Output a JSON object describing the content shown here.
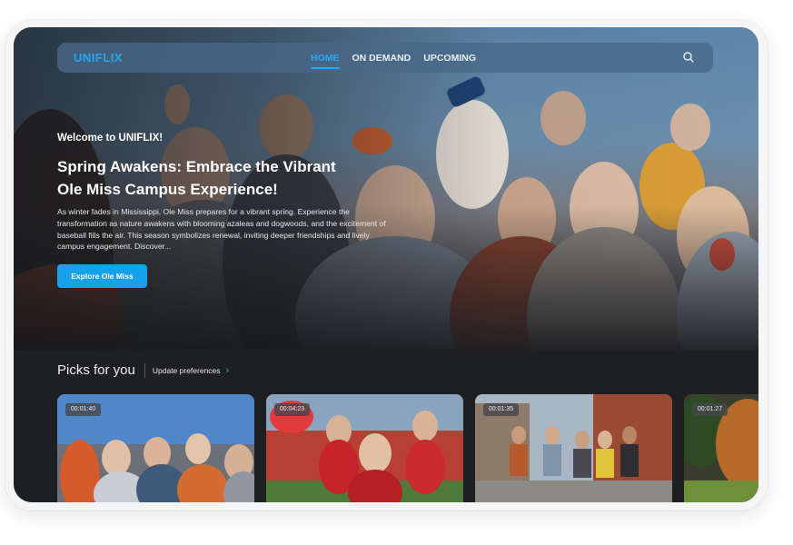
{
  "nav": {
    "logo": "UNIFLIX",
    "links": [
      {
        "label": "HOME",
        "active": true
      },
      {
        "label": "ON DEMAND",
        "active": false
      },
      {
        "label": "UPCOMING",
        "active": false
      }
    ],
    "search_icon": "search-icon"
  },
  "hero": {
    "welcome": "Welcome to UNIFLIX!",
    "title_line1": "Spring Awakens: Embrace the Vibrant",
    "title_line2": "Ole Miss Campus Experience!",
    "description": "As winter fades in Mississippi, Ole Miss prepares for a vibrant spring. Experience the transformation as nature awakens with blooming azaleas and dogwoods, and the excitement of baseball fills the air. This season symbolizes renewal, inviting deeper friendships and lively campus engagement. Discover...",
    "cta_label": "Explore Ole Miss"
  },
  "picks": {
    "title": "Picks for you",
    "update_label": "Update preferences",
    "cards": [
      {
        "duration": "00:01:40"
      },
      {
        "duration": "00:04:23"
      },
      {
        "duration": "00:01:35"
      },
      {
        "duration": "00:01:27"
      }
    ]
  },
  "colors": {
    "accent": "#16a2ea",
    "background": "#1e1f22"
  }
}
